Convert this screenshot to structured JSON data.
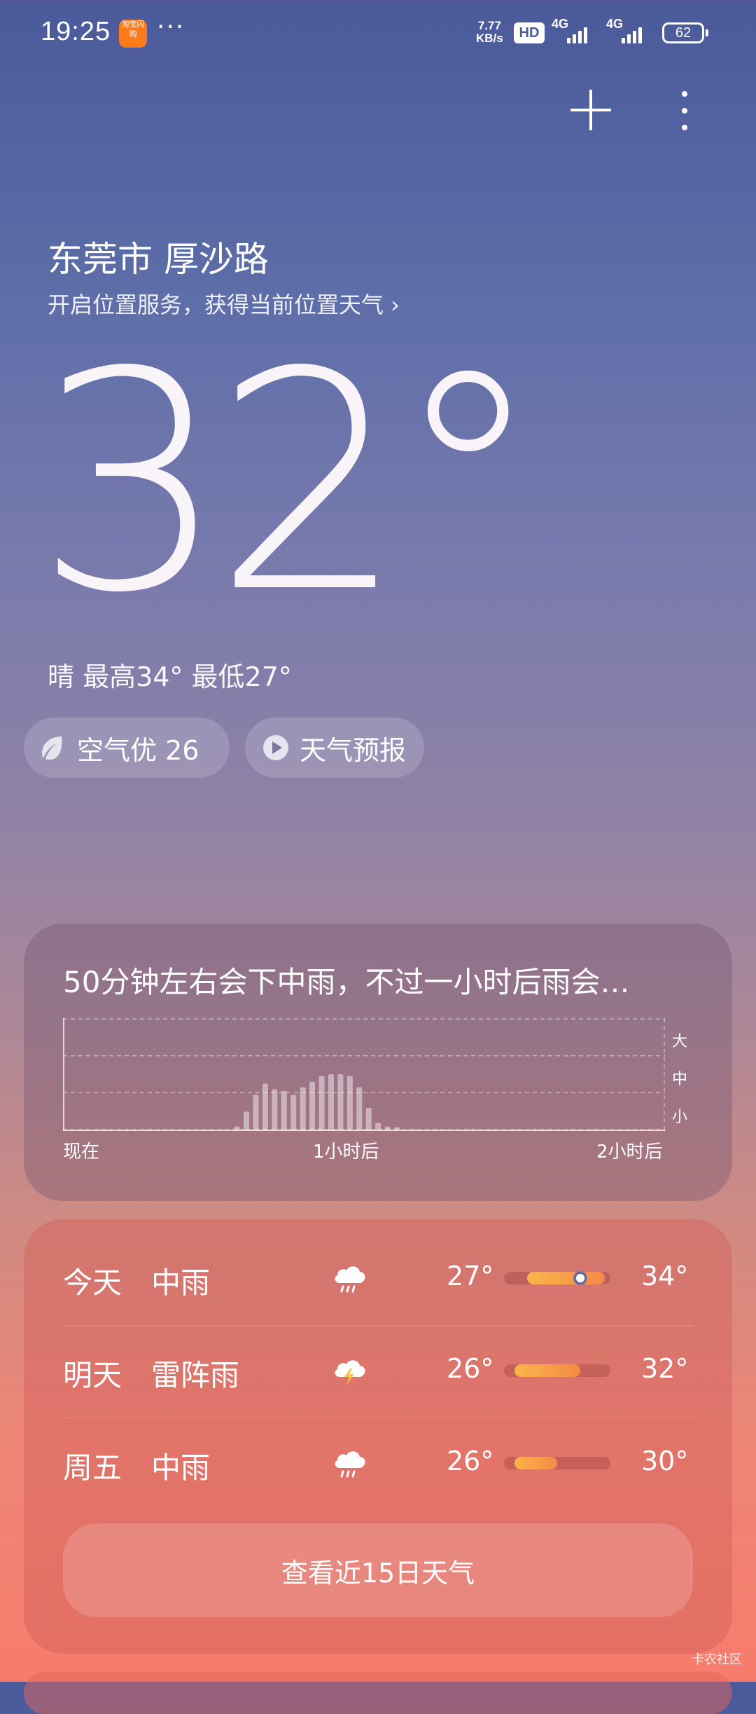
{
  "status_bar": {
    "time": "19:25",
    "app_icon_label": "淘宝闪购",
    "overflow": "···",
    "speed_value": "7.77",
    "speed_unit": "KB/s",
    "hd_badge": "HD",
    "network_1": "4G",
    "network_2": "4G",
    "battery": "62"
  },
  "header": {
    "add_icon": "plus-icon",
    "more_icon": "more-vertical-icon"
  },
  "location": {
    "city": "东莞市 厚沙路",
    "location_service_prompt": "开启位置服务，获得当前位置天气 ›"
  },
  "current": {
    "temperature": "32°",
    "summary": "晴  最高34° 最低27°"
  },
  "pills": {
    "aqi_label": "空气优 26",
    "forecast_label": "天气预报"
  },
  "rain_card": {
    "title": "50分钟左右会下中雨，不过一小时后雨会…",
    "x_labels": [
      "现在",
      "1小时后",
      "2小时后"
    ],
    "levels": [
      "大",
      "中",
      "小"
    ]
  },
  "chart_data": {
    "type": "bar",
    "title": "50分钟左右会下中雨，不过一小时后雨会…",
    "x_tick_labels": [
      "现在",
      "1小时后",
      "2小时后"
    ],
    "y_tick_labels": [
      "小",
      "中",
      "大"
    ],
    "ylim": [
      0,
      3
    ],
    "values": [
      0,
      0,
      0,
      0,
      0,
      0,
      0,
      0,
      0,
      0,
      0,
      0,
      0,
      0,
      0,
      0,
      0,
      0,
      0.1,
      0.5,
      0.95,
      1.25,
      1.1,
      1.05,
      0.95,
      1.15,
      1.3,
      1.45,
      1.5,
      1.5,
      1.45,
      1.15,
      0.6,
      0.2,
      0.1,
      0.08,
      0,
      0,
      0,
      0,
      0,
      0,
      0,
      0,
      0,
      0,
      0,
      0,
      0,
      0,
      0,
      0,
      0,
      0,
      0,
      0,
      0,
      0,
      0,
      0,
      0,
      0,
      0,
      0
    ]
  },
  "forecast": [
    {
      "day": "今天",
      "condition": "中雨",
      "icon": "rain-cloud-icon",
      "low": "27°",
      "high": "34°",
      "range": [
        0.22,
        0.95
      ],
      "current_marker": 0.72
    },
    {
      "day": "明天",
      "condition": "雷阵雨",
      "icon": "thunderstorm-cloud-icon",
      "low": "26°",
      "high": "32°",
      "range": [
        0.1,
        0.72
      ]
    },
    {
      "day": "周五",
      "condition": "中雨",
      "icon": "rain-cloud-icon",
      "low": "26°",
      "high": "30°",
      "range": [
        0.1,
        0.5
      ]
    }
  ],
  "more_days_button": "查看近15日天气",
  "watermark": "卡农社区",
  "colors": {
    "bg_top": "#4a5a9a",
    "bg_bottom": "#f77c6c",
    "bar_fill_start": "#f9b54a",
    "bar_fill_end": "#f58a46"
  }
}
